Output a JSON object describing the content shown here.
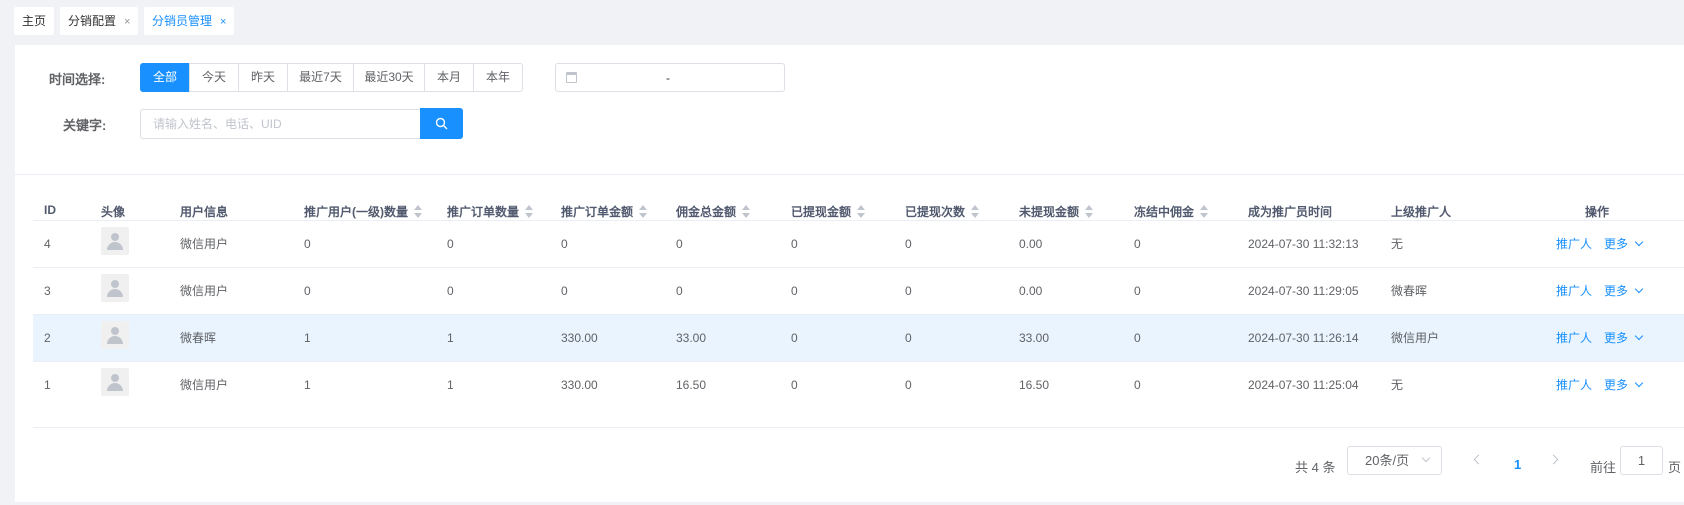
{
  "tabs": [
    {
      "label": "主页",
      "closable": false
    },
    {
      "label": "分销配置",
      "closable": true
    },
    {
      "label": "分销员管理",
      "closable": true,
      "active": true
    }
  ],
  "tab_close_glyph": "×",
  "filter": {
    "time_label": "时间选择:",
    "time_options": [
      "全部",
      "今天",
      "昨天",
      "最近7天",
      "最近30天",
      "本月",
      "本年"
    ],
    "time_selected": "全部",
    "date_range_separator": "-",
    "keyword_label": "关键字:",
    "keyword_placeholder": "请输入姓名、电话、UID",
    "keyword_value": ""
  },
  "table": {
    "columns": [
      "ID",
      "头像",
      "用户信息",
      "推广用户(一级)数量",
      "推广订单数量",
      "推广订单金额",
      "佣金总金额",
      "已提现金额",
      "已提现次数",
      "未提现金额",
      "冻结中佣金",
      "成为推广员时间",
      "上级推广人",
      "操作"
    ],
    "sortable_columns": [
      "推广用户(一级)数量",
      "推广订单数量",
      "推广订单金额",
      "佣金总金额",
      "已提现金额",
      "已提现次数",
      "未提现金额",
      "冻结中佣金"
    ],
    "rows": [
      {
        "id": "4",
        "user": "微信用户",
        "promo_users": "0",
        "promo_orders": "0",
        "promo_amount": "0",
        "commission_total": "0",
        "withdrawn_amount": "0",
        "withdraw_count": "0",
        "unwithdrawn": "0.00",
        "frozen": "0",
        "since": "2024-07-30 11:32:13",
        "superior": "无",
        "highlighted": false
      },
      {
        "id": "3",
        "user": "微信用户",
        "promo_users": "0",
        "promo_orders": "0",
        "promo_amount": "0",
        "commission_total": "0",
        "withdrawn_amount": "0",
        "withdraw_count": "0",
        "unwithdrawn": "0.00",
        "frozen": "0",
        "since": "2024-07-30 11:29:05",
        "superior": "微春晖",
        "highlighted": false
      },
      {
        "id": "2",
        "user": "微春晖",
        "promo_users": "1",
        "promo_orders": "1",
        "promo_amount": "330.00",
        "commission_total": "33.00",
        "withdrawn_amount": "0",
        "withdraw_count": "0",
        "unwithdrawn": "33.00",
        "frozen": "0",
        "since": "2024-07-30 11:26:14",
        "superior": "微信用户",
        "highlighted": true
      },
      {
        "id": "1",
        "user": "微信用户",
        "promo_users": "1",
        "promo_orders": "1",
        "promo_amount": "330.00",
        "commission_total": "16.50",
        "withdrawn_amount": "0",
        "withdraw_count": "0",
        "unwithdrawn": "16.50",
        "frozen": "0",
        "since": "2024-07-30 11:25:04",
        "superior": "无",
        "highlighted": false
      }
    ],
    "action_promoter": "推广人",
    "action_more": "更多"
  },
  "pagination": {
    "total_text": "共 4 条",
    "page_size": "20条/页",
    "current_page": "1",
    "goto_label": "前往",
    "goto_value": "1",
    "page_suffix": "页"
  },
  "colors": {
    "primary": "#1890ff",
    "row_highlight": "#e9f4fe",
    "border": "#dcdfe6"
  }
}
